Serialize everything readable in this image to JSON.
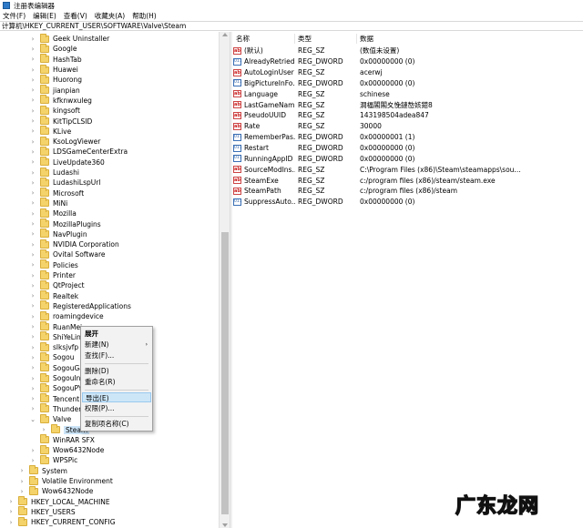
{
  "window": {
    "title": "注册表编辑器"
  },
  "menu": [
    "文件(F)",
    "编辑(E)",
    "查看(V)",
    "收藏夹(A)",
    "帮助(H)"
  ],
  "address": "计算机\\HKEY_CURRENT_USER\\SOFTWARE\\Valve\\Steam",
  "tree": [
    {
      "label": "Geek Uninstaller",
      "level": 3,
      "arrow": ">"
    },
    {
      "label": "Google",
      "level": 3,
      "arrow": ">"
    },
    {
      "label": "HashTab",
      "level": 3,
      "arrow": ">"
    },
    {
      "label": "Huawei",
      "level": 3,
      "arrow": ">"
    },
    {
      "label": "Huorong",
      "level": 3,
      "arrow": ">"
    },
    {
      "label": "jianpian",
      "level": 3,
      "arrow": ">"
    },
    {
      "label": "kfknwxuleg",
      "level": 3,
      "arrow": ">"
    },
    {
      "label": "kingsoft",
      "level": 3,
      "arrow": ">"
    },
    {
      "label": "KitTipCLSID",
      "level": 3,
      "arrow": ">"
    },
    {
      "label": "KLive",
      "level": 3,
      "arrow": ">"
    },
    {
      "label": "KsoLogViewer",
      "level": 3,
      "arrow": ">"
    },
    {
      "label": "LDSGameCenterExtra",
      "level": 3,
      "arrow": ">"
    },
    {
      "label": "LiveUpdate360",
      "level": 3,
      "arrow": ">"
    },
    {
      "label": "Ludashi",
      "level": 3,
      "arrow": ">"
    },
    {
      "label": "LudashiLspUrl",
      "level": 3,
      "arrow": ">"
    },
    {
      "label": "Microsoft",
      "level": 3,
      "arrow": ">"
    },
    {
      "label": "MiNi",
      "level": 3,
      "arrow": ">"
    },
    {
      "label": "Mozilla",
      "level": 3,
      "arrow": ">"
    },
    {
      "label": "MozillaPlugins",
      "level": 3,
      "arrow": ">"
    },
    {
      "label": "NavPlugin",
      "level": 3,
      "arrow": ">"
    },
    {
      "label": "NVIDIA Corporation",
      "level": 3,
      "arrow": ">"
    },
    {
      "label": "Ovital Software",
      "level": 3,
      "arrow": ">"
    },
    {
      "label": "Policies",
      "level": 3,
      "arrow": ">"
    },
    {
      "label": "Printer",
      "level": 3,
      "arrow": ">"
    },
    {
      "label": "QtProject",
      "level": 3,
      "arrow": ">"
    },
    {
      "label": "Realtek",
      "level": 3,
      "arrow": ">"
    },
    {
      "label": "RegisteredApplications",
      "level": 3,
      "arrow": ">"
    },
    {
      "label": "roamingdevice",
      "level": 3,
      "arrow": ">"
    },
    {
      "label": "RuanMei",
      "level": 3,
      "arrow": ">"
    },
    {
      "label": "ShiYeLine",
      "level": 3,
      "arrow": ">"
    },
    {
      "label": "slksjvfp",
      "level": 3,
      "arrow": ">"
    },
    {
      "label": "Sogou",
      "level": 3,
      "arrow": ">"
    },
    {
      "label": "SogouGame",
      "level": 3,
      "arrow": ">"
    },
    {
      "label": "SogouInput",
      "level": 3,
      "arrow": ">"
    },
    {
      "label": "SogouPY",
      "level": 3,
      "arrow": ">"
    },
    {
      "label": "Tencent",
      "level": 3,
      "arrow": ">"
    },
    {
      "label": "Thunder Network",
      "level": 3,
      "arrow": ">"
    },
    {
      "label": "Valve",
      "level": 3,
      "arrow": "v"
    },
    {
      "label": "Steam",
      "level": 4,
      "arrow": ">",
      "selected": true
    },
    {
      "label": "WinRAR SFX",
      "level": 3,
      "arrow": ""
    },
    {
      "label": "Wow6432Node",
      "level": 3,
      "arrow": ">"
    },
    {
      "label": "WPSPic",
      "level": 3,
      "arrow": ">"
    },
    {
      "label": "System",
      "level": 2,
      "arrow": ">"
    },
    {
      "label": "Volatile Environment",
      "level": 2,
      "arrow": ">"
    },
    {
      "label": "Wow6432Node",
      "level": 2,
      "arrow": ">"
    },
    {
      "label": "HKEY_LOCAL_MACHINE",
      "level": 1,
      "arrow": ">"
    },
    {
      "label": "HKEY_USERS",
      "level": 1,
      "arrow": ">"
    },
    {
      "label": "HKEY_CURRENT_CONFIG",
      "level": 1,
      "arrow": ">"
    }
  ],
  "columns": {
    "name": "名称",
    "type": "类型",
    "data": "数据"
  },
  "values": [
    {
      "name": "(默认)",
      "type": "REG_SZ",
      "data": "(数值未设置)",
      "icon": "string-value-icon"
    },
    {
      "name": "AlreadyRetried...",
      "type": "REG_DWORD",
      "data": "0x00000000 (0)",
      "icon": "binary-value-icon"
    },
    {
      "name": "AutoLoginUser",
      "type": "REG_SZ",
      "data": "acerwj",
      "icon": "string-value-icon"
    },
    {
      "name": "BigPictureInFo...",
      "type": "REG_DWORD",
      "data": "0x00000000 (0)",
      "icon": "binary-value-icon"
    },
    {
      "name": "Language",
      "type": "REG_SZ",
      "data": "schinese",
      "icon": "string-value-icon"
    },
    {
      "name": "LastGameNam...",
      "type": "REG_SZ",
      "data": "澗楅閣閣夊悗鏈嶅姟鍣8",
      "icon": "string-value-icon"
    },
    {
      "name": "PseudoUUID",
      "type": "REG_SZ",
      "data": "143198504adea847",
      "icon": "string-value-icon"
    },
    {
      "name": "Rate",
      "type": "REG_SZ",
      "data": "30000",
      "icon": "string-value-icon"
    },
    {
      "name": "RememberPas...",
      "type": "REG_DWORD",
      "data": "0x00000001 (1)",
      "icon": "binary-value-icon"
    },
    {
      "name": "Restart",
      "type": "REG_DWORD",
      "data": "0x00000000 (0)",
      "icon": "binary-value-icon"
    },
    {
      "name": "RunningAppID",
      "type": "REG_DWORD",
      "data": "0x00000000 (0)",
      "icon": "binary-value-icon"
    },
    {
      "name": "SourceModIns...",
      "type": "REG_SZ",
      "data": "C:\\Program Files (x86)\\Steam\\steamapps\\sou...",
      "icon": "string-value-icon"
    },
    {
      "name": "SteamExe",
      "type": "REG_SZ",
      "data": "c:/program files (x86)/steam/steam.exe",
      "icon": "string-value-icon"
    },
    {
      "name": "SteamPath",
      "type": "REG_SZ",
      "data": "c:/program files (x86)/steam",
      "icon": "string-value-icon"
    },
    {
      "name": "SuppressAuto...",
      "type": "REG_DWORD",
      "data": "0x00000000 (0)",
      "icon": "binary-value-icon"
    }
  ],
  "context_menu": {
    "expand": "展开",
    "new": "新建(N)",
    "find": "查找(F)...",
    "delete": "删除(D)",
    "rename": "重命名(R)",
    "export": "导出(E)",
    "permissions": "权限(P)...",
    "copy_key_name": "复制项名称(C)"
  },
  "watermark": "广东龙网"
}
